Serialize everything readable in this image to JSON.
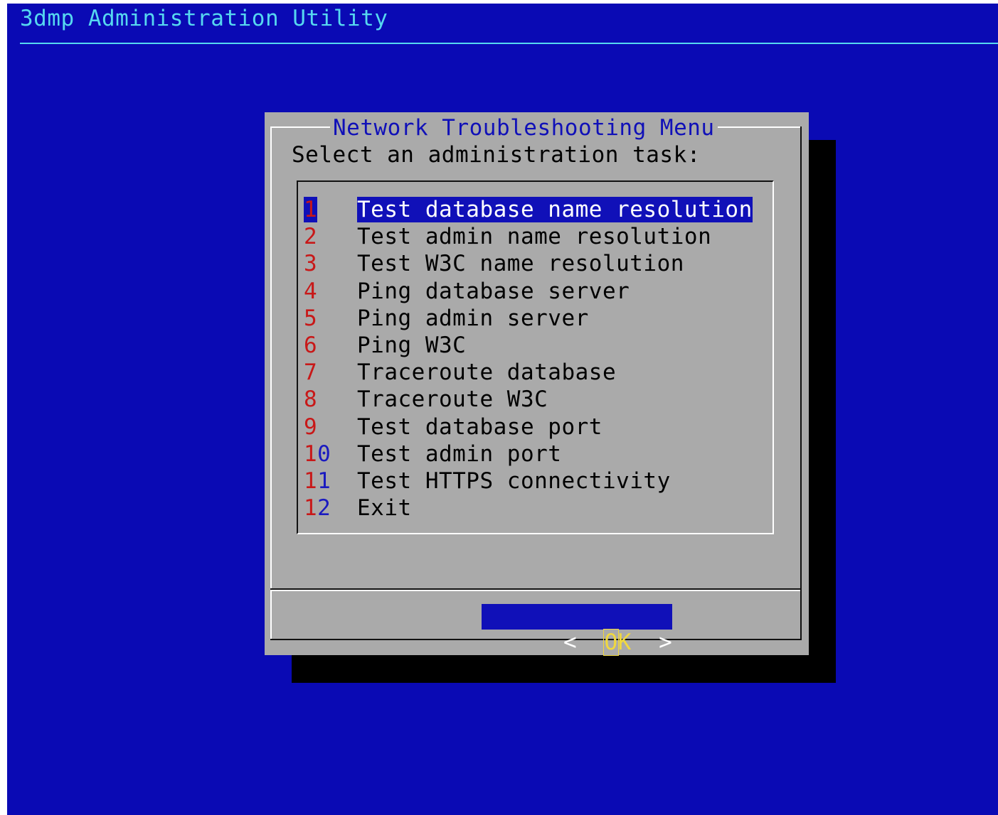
{
  "backtitle": "3dmp Administration Utility",
  "dialog": {
    "title": "Network Troubleshooting Menu",
    "prompt": "Select an administration task:",
    "selected_index": 0,
    "items": [
      {
        "tag": "1",
        "label": "Test database name resolution"
      },
      {
        "tag": "2",
        "label": "Test admin name resolution"
      },
      {
        "tag": "3",
        "label": "Test W3C name resolution"
      },
      {
        "tag": "4",
        "label": "Ping database server"
      },
      {
        "tag": "5",
        "label": "Ping admin server"
      },
      {
        "tag": "6",
        "label": "Ping W3C"
      },
      {
        "tag": "7",
        "label": "Traceroute database"
      },
      {
        "tag": "8",
        "label": "Traceroute W3C"
      },
      {
        "tag": "9",
        "label": "Test database port"
      },
      {
        "tag": "10",
        "label": "Test admin port"
      },
      {
        "tag": "11",
        "label": "Test HTTPS connectivity"
      },
      {
        "tag": "12",
        "label": "Exit"
      }
    ],
    "ok_button": {
      "left_bracket": "<",
      "hotkey": "O",
      "rest": "K",
      "right_bracket": ">"
    }
  },
  "colors": {
    "background": "#0a0ab4",
    "backtitle": "#56d8f0",
    "dialog": "#aaaaaa",
    "title": "#1010b8",
    "hotkey": "#c81818",
    "selection": "#1010b8",
    "button_text": "#f0d840"
  }
}
